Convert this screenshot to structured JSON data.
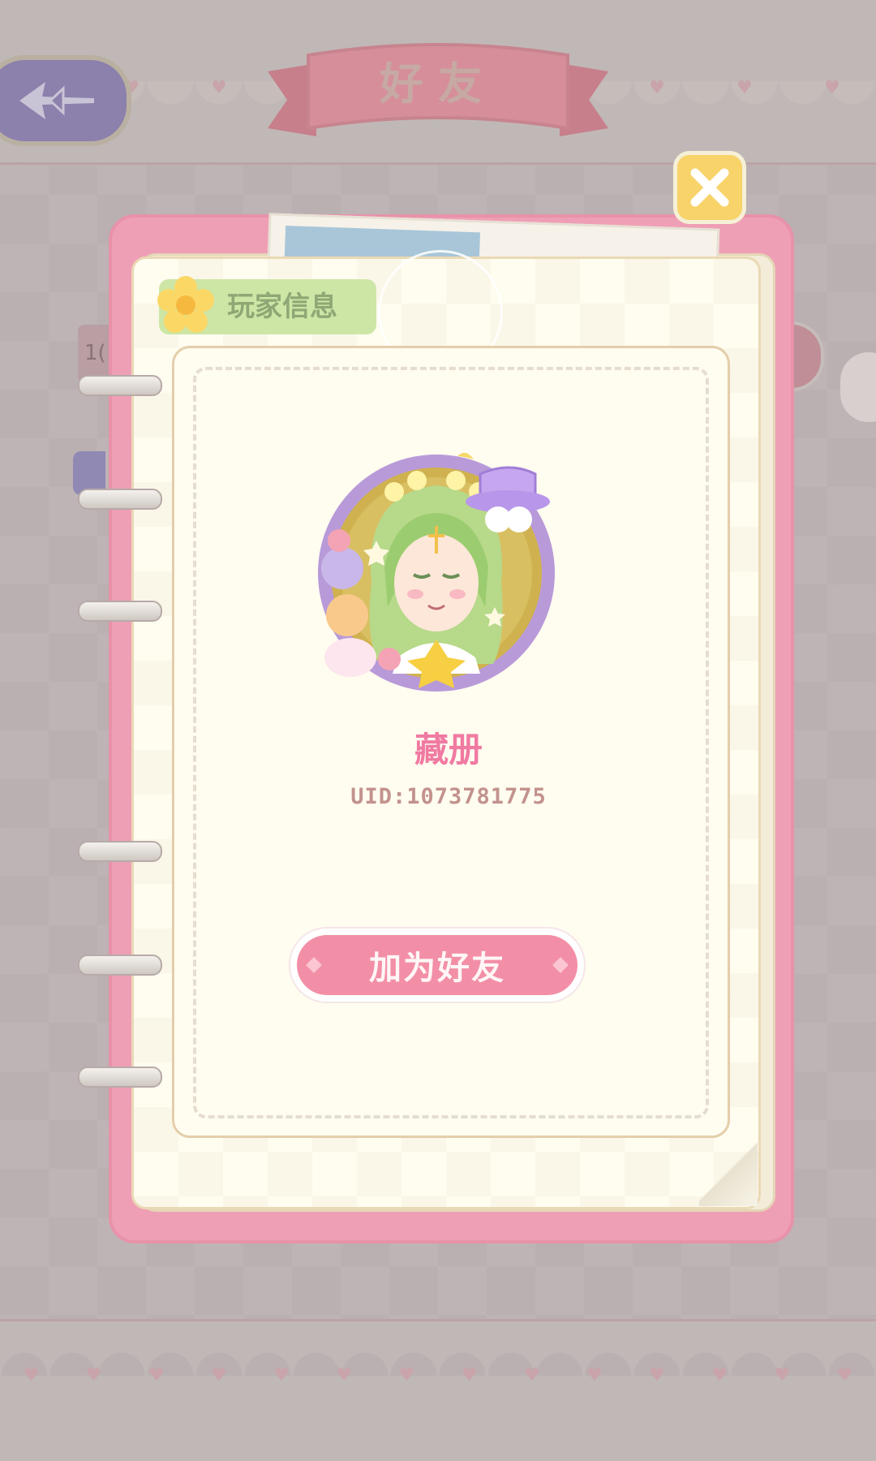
{
  "header": {
    "title": "好友"
  },
  "dialog": {
    "section_tag": "玩家信息",
    "player": {
      "nickname": "藏册",
      "uid_text": "UID:1073781775"
    },
    "add_friend_label": "加为好友"
  },
  "background": {
    "left_tab_fragment": "1("
  },
  "icons": {
    "back": "shuriken-arrow-icon",
    "close": "close-x-icon",
    "tag": "flower-icon",
    "avatar": "avatar-portrait-icon"
  },
  "colors": {
    "notebook_pink": "#ef9fb5",
    "button_pink": "#f28fa6",
    "nickname_pink": "#f07aa2",
    "close_yellow": "#f8d36a",
    "tag_green": "#cde6a6",
    "back_purple": "#8c80ac"
  }
}
